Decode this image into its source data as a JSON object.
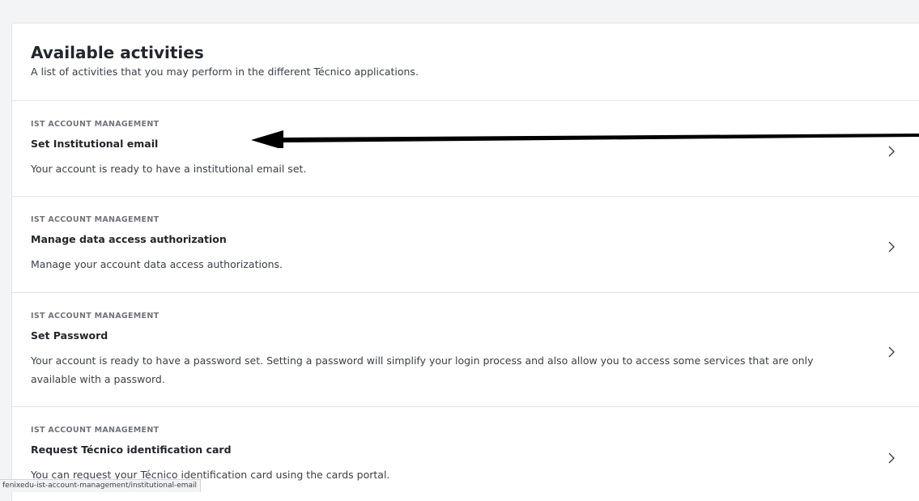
{
  "header": {
    "title": "Available activities",
    "subtitle": "A list of activities that you may perform in the different Técnico applications."
  },
  "activities": [
    {
      "category": "IST ACCOUNT MANAGEMENT",
      "title": "Set Institutional email",
      "description": "Your account is ready to have a institutional email set."
    },
    {
      "category": "IST ACCOUNT MANAGEMENT",
      "title": "Manage data access authorization",
      "description": "Manage your account data access authorizations."
    },
    {
      "category": "IST ACCOUNT MANAGEMENT",
      "title": "Set Password",
      "description": "Your account is ready to have a password set. Setting a password will simplify your login process and also allow you to access some services that are only available with a password."
    },
    {
      "category": "IST ACCOUNT MANAGEMENT",
      "title": "Request Técnico identification card",
      "description": "You can request your Técnico identification card using the cards portal."
    }
  ],
  "icons": {
    "chevron": "chevron-right-icon",
    "annotation": "arrow-left-icon"
  },
  "status_bar": {
    "url": "fenixedu-ist-account-management/institutional-email"
  }
}
